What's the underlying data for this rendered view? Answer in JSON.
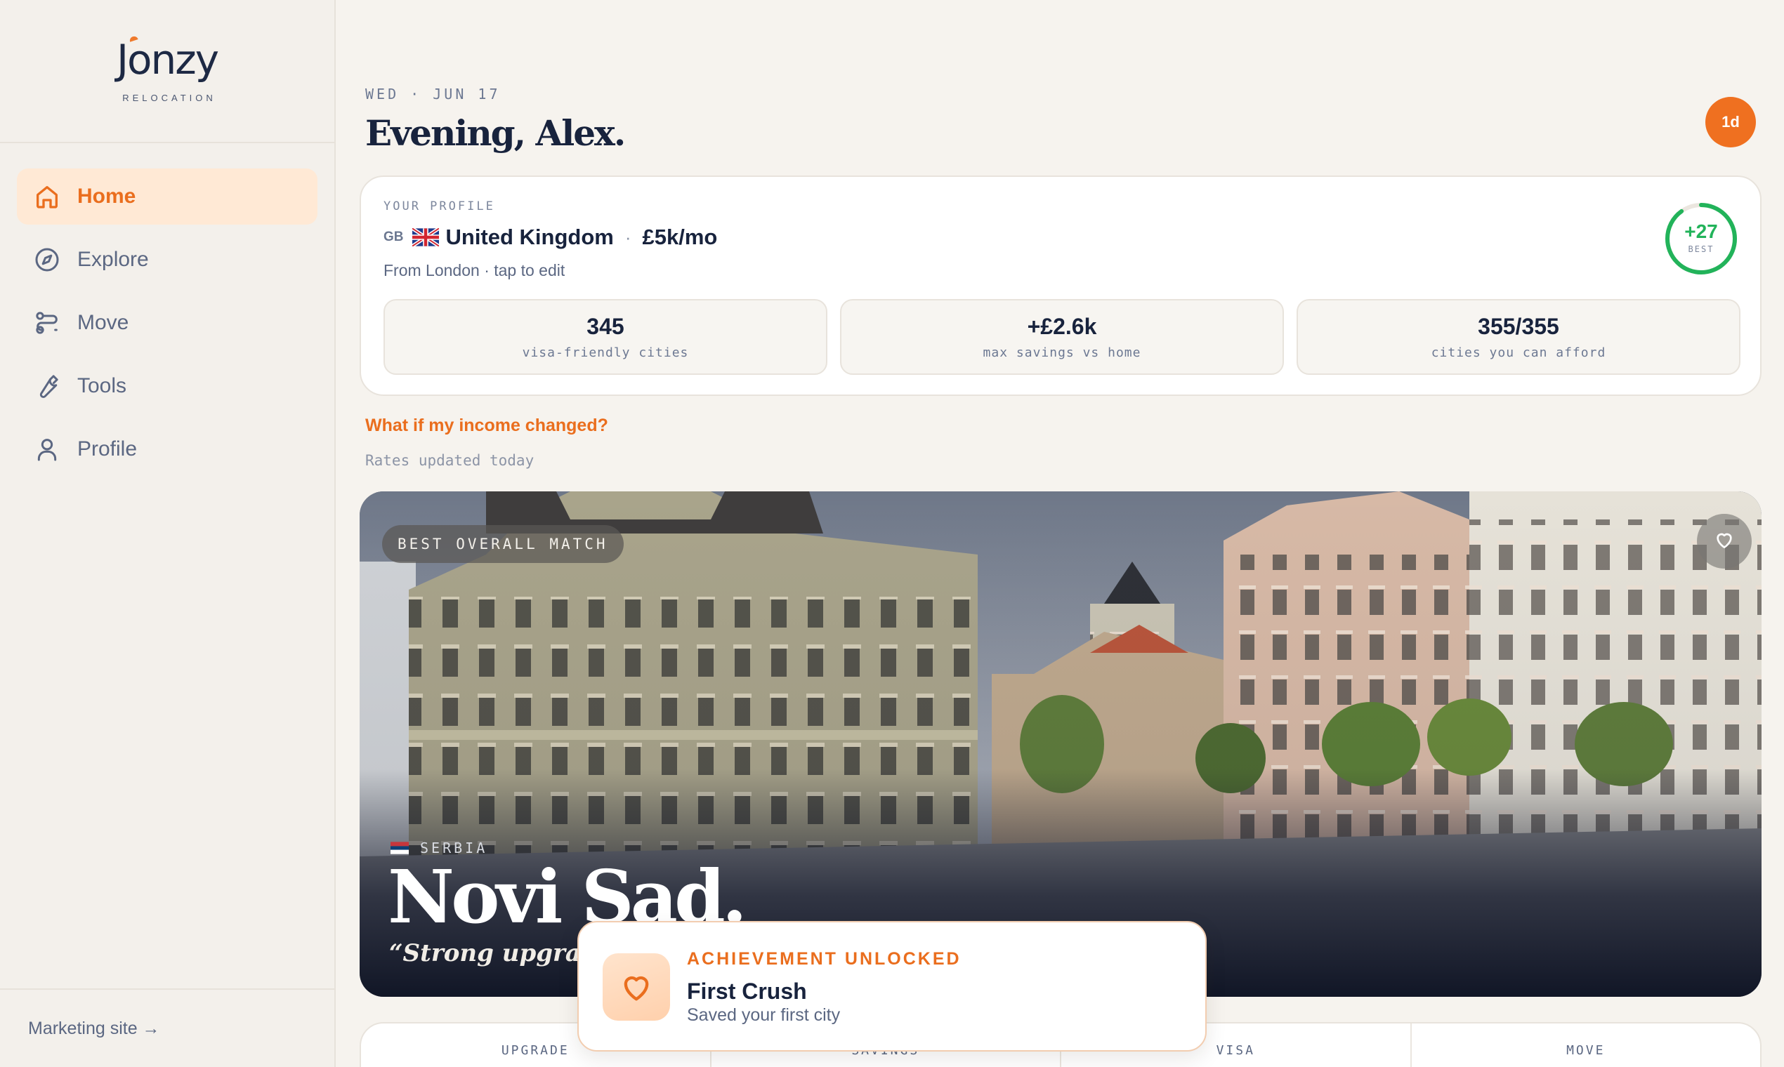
{
  "brand": {
    "name": "Jonzy",
    "subtitle": "RELOCATION"
  },
  "nav": [
    {
      "label": "Home",
      "icon": "home-icon",
      "active": true
    },
    {
      "label": "Explore",
      "icon": "compass-icon",
      "active": false
    },
    {
      "label": "Move",
      "icon": "route-icon",
      "active": false
    },
    {
      "label": "Tools",
      "icon": "wrench-icon",
      "active": false
    },
    {
      "label": "Profile",
      "icon": "user-icon",
      "active": false
    }
  ],
  "footer": {
    "marketing_link": "Marketing site →"
  },
  "header": {
    "date": "WED · JUN 17",
    "greeting": "Evening, Alex.",
    "streak_badge": "1d"
  },
  "profile": {
    "eyebrow": "YOUR PROFILE",
    "country_code": "GB",
    "country": "United Kingdom",
    "separator": "·",
    "income": "£5k/mo",
    "from": "From London · tap to edit",
    "best_score": "+27",
    "best_label": "BEST",
    "best_ring_fraction": 0.9,
    "stats": [
      {
        "value": "345",
        "label": "visa-friendly cities"
      },
      {
        "value": "+£2.6k",
        "label": "max savings vs home"
      },
      {
        "value": "355/355",
        "label": "cities you can afford"
      }
    ]
  },
  "whatif_link": "What if my income changed?",
  "rates_status": "Rates updated today",
  "hero": {
    "badge": "BEST OVERALL MATCH",
    "country": "SERBIA",
    "city": "Novi Sad.",
    "tagline": "“Strong upgrade”"
  },
  "toast": {
    "eyebrow": "ACHIEVEMENT UNLOCKED",
    "title": "First Crush",
    "subtitle": "Saved your first city",
    "icon": "heart-icon"
  },
  "strip": {
    "cells": [
      "UPGRADE",
      "SAVINGS",
      "VISA",
      "MOVE"
    ]
  },
  "colors": {
    "accent": "#ea6e1e",
    "positive": "#22b35a",
    "ink": "#18233d"
  }
}
